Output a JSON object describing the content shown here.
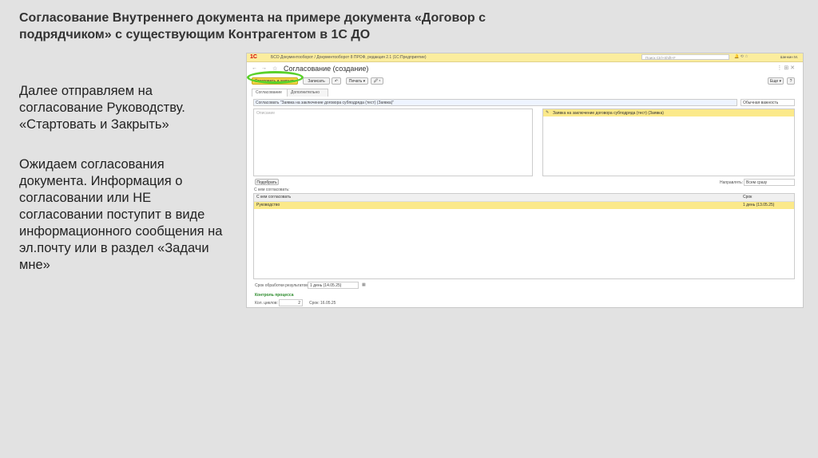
{
  "slide": {
    "title": "Согласование Внутреннего документа на примере документа «Договор с подрядчиком» с существующим Контрагентом в 1С ДО",
    "paragraph1": "Далее отправляем на согласование Руководству. «Стартовать и Закрыть»",
    "paragraph2": "Ожидаем согласования документа. Информация о согласовании или НЕ согласовании поступит в виде информационного сообщения на эл.почту или в раздел «Задачи мне»"
  },
  "screenshot": {
    "logo": "1С",
    "app_title": "БСО Документооборот / Документооборот 8 ПРОФ, редакция 2.1 (1С:Предприятие)",
    "search_placeholder": "Поиск Ctrl+Shift+F",
    "user": "Шинкин М.",
    "discussion_label": "Обсуждения",
    "nav_back": "←",
    "nav_forward": "→",
    "star": "☆",
    "form_title": "Согласование (создание)",
    "header_icons": "⋮  ⊞  ✕",
    "toolbar": {
      "start_close": "Стартовать и закрыть",
      "save": "Записать",
      "print": "Печать ▾",
      "attach": "🖉 ▾",
      "more": "Еще ▾",
      "help": "?"
    },
    "tabs": [
      "Согласование",
      "Дополнительно"
    ],
    "subject": "Согласовать \"Заявка на заключение договора субподряда (тест) (Заявка)\"",
    "importance": "Обычная важность",
    "description_placeholder": "Описание",
    "attachment": "Заявка на заключение договора субподряда (тест) (Заявка)",
    "pick_button": "Подобрать",
    "direction_label": "Направлять:",
    "direction_value": "Всем сразу",
    "approvers_label": "С кем согласовать:",
    "table": {
      "headers": [
        "С кем согласовать",
        "Срок"
      ],
      "rows": [
        [
          "Руководство",
          "1 день (13.05.25)"
        ]
      ]
    },
    "deadline_label": "Срок обработки результатов:",
    "deadline_value": "1 день (14.05.25)",
    "control_label": "Контроль процесса",
    "cycles_label": "Кол. циклов:",
    "cycles_value": "2",
    "term_label": "Срок:",
    "term_value": "16.05.25"
  }
}
